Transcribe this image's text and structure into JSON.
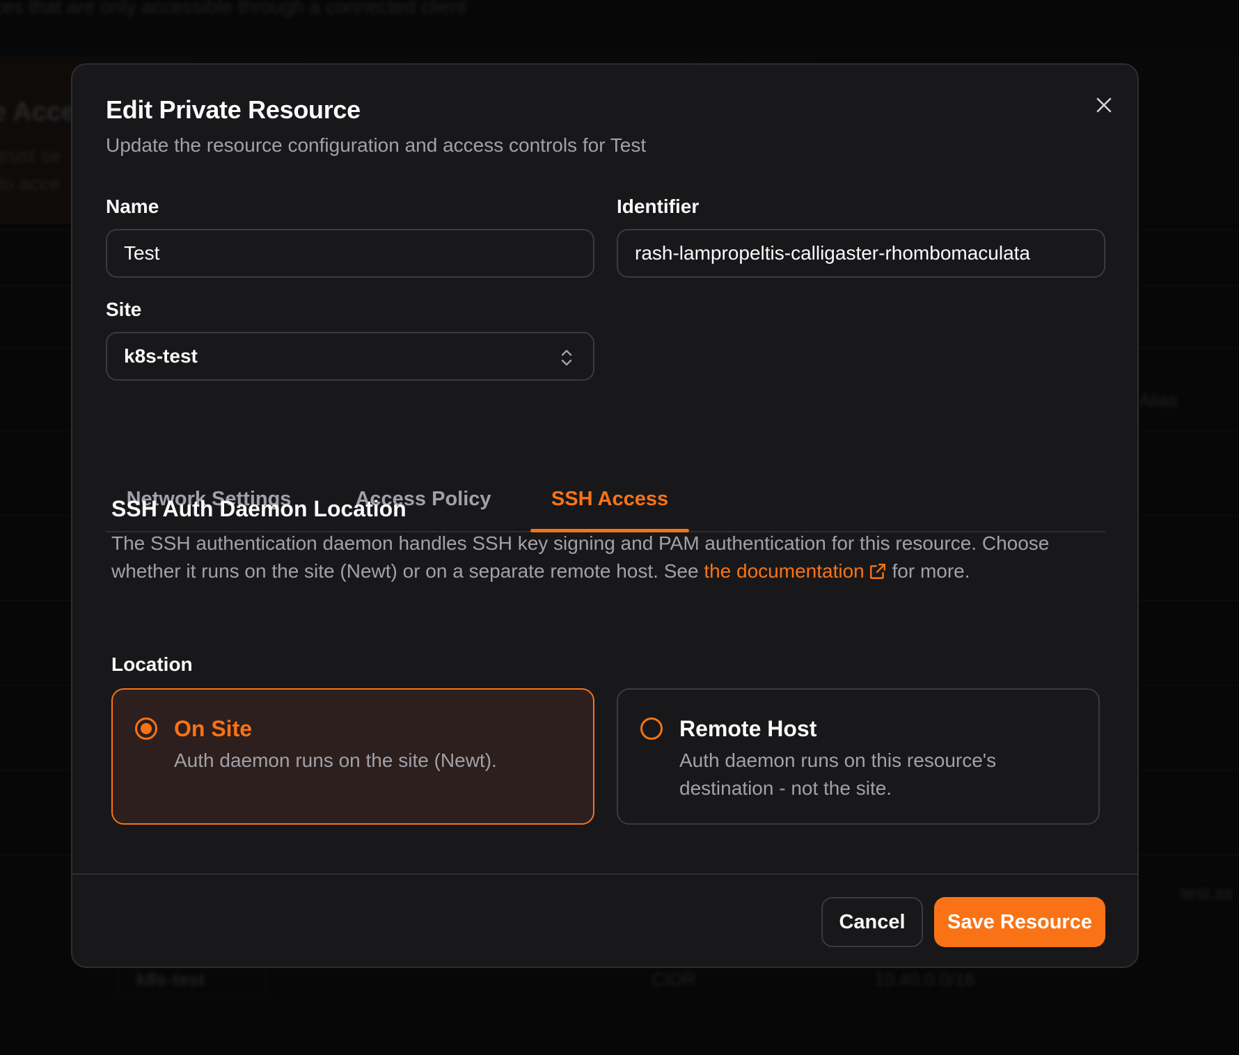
{
  "background": {
    "header_text": "ces that are only accessible through a connected client",
    "section_title": "e Acce",
    "section_desc_line1": "trust se",
    "section_desc_line2": "to acce",
    "column_alias": "Alias",
    "row_site_chip": "k8s-test",
    "row_type": "CIDR",
    "row_value": "10.40.0.0/16",
    "row_alias": "test.ss"
  },
  "dialog": {
    "title": "Edit Private Resource",
    "subtitle": "Update the resource configuration and access controls for Test",
    "close_icon": "close-icon"
  },
  "form": {
    "name_label": "Name",
    "name_value": "Test",
    "identifier_label": "Identifier",
    "identifier_value": "rash-lampropeltis-calligaster-rhombomaculata",
    "site_label": "Site",
    "site_value": "k8s-test"
  },
  "tabs": [
    {
      "label": "Network Settings",
      "active": false
    },
    {
      "label": "Access Policy",
      "active": false
    },
    {
      "label": "SSH Access",
      "active": true
    }
  ],
  "ssh": {
    "section_title": "SSH Auth Daemon Location",
    "desc_part1": "The SSH authentication daemon handles SSH key signing and PAM authentication for this resource. Choose whether it runs on the site (Newt) or on a separate remote host. See ",
    "doc_link": "the documentation",
    "desc_part2": " for more.",
    "location_label": "Location",
    "options": [
      {
        "title": "On Site",
        "description": "Auth daemon runs on the site (Newt).",
        "selected": true
      },
      {
        "title": "Remote Host",
        "description": "Auth daemon runs on this resource's destination - not the site.",
        "selected": false
      }
    ]
  },
  "footer": {
    "cancel_label": "Cancel",
    "save_label": "Save Resource"
  },
  "colors": {
    "accent": "#f97316",
    "dialog_bg": "#18181b",
    "selected_card_bg": "#2c1f1d"
  }
}
